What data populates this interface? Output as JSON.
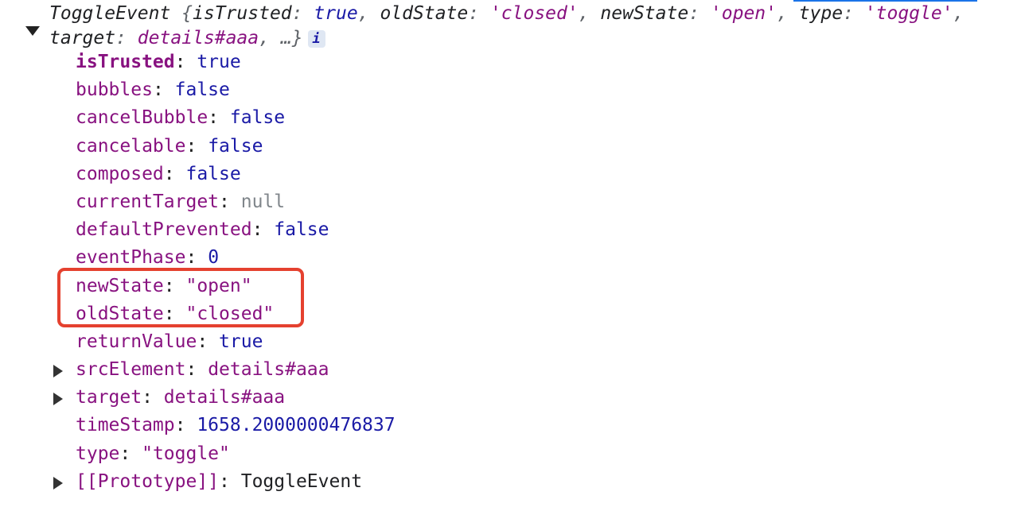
{
  "summary": {
    "class_name": "ToggleEvent",
    "entries": [
      {
        "key": "isTrusted",
        "value": "true",
        "kind": "bool"
      },
      {
        "key": "oldState",
        "value": "'closed'",
        "kind": "str"
      },
      {
        "key": "newState",
        "value": "'open'",
        "kind": "str"
      },
      {
        "key": "type",
        "value": "'toggle'",
        "kind": "str"
      },
      {
        "key": "target",
        "value": "details#aaa",
        "kind": "node"
      }
    ],
    "ellipsis": "…",
    "info_badge": "i"
  },
  "properties": [
    {
      "key": "isTrusted",
      "value": "true",
      "kind": "bool",
      "own": true,
      "expandable": false
    },
    {
      "key": "bubbles",
      "value": "false",
      "kind": "bool",
      "own": false,
      "expandable": false
    },
    {
      "key": "cancelBubble",
      "value": "false",
      "kind": "bool",
      "own": false,
      "expandable": false
    },
    {
      "key": "cancelable",
      "value": "false",
      "kind": "bool",
      "own": false,
      "expandable": false
    },
    {
      "key": "composed",
      "value": "false",
      "kind": "bool",
      "own": false,
      "expandable": false
    },
    {
      "key": "currentTarget",
      "value": "null",
      "kind": "null",
      "own": false,
      "expandable": false
    },
    {
      "key": "defaultPrevented",
      "value": "false",
      "kind": "bool",
      "own": false,
      "expandable": false
    },
    {
      "key": "eventPhase",
      "value": "0",
      "kind": "num",
      "own": false,
      "expandable": false
    },
    {
      "key": "newState",
      "value": "\"open\"",
      "kind": "str",
      "own": false,
      "expandable": false
    },
    {
      "key": "oldState",
      "value": "\"closed\"",
      "kind": "str",
      "own": false,
      "expandable": false
    },
    {
      "key": "returnValue",
      "value": "true",
      "kind": "bool",
      "own": false,
      "expandable": false
    },
    {
      "key": "srcElement",
      "value": "details#aaa",
      "kind": "node",
      "own": false,
      "expandable": true
    },
    {
      "key": "target",
      "value": "details#aaa",
      "kind": "node",
      "own": false,
      "expandable": true
    },
    {
      "key": "timeStamp",
      "value": "1658.2000000476837",
      "kind": "num",
      "own": false,
      "expandable": false
    },
    {
      "key": "type",
      "value": "\"toggle\"",
      "kind": "str",
      "own": false,
      "expandable": false
    },
    {
      "key": "[[Prototype]]",
      "value": "ToggleEvent",
      "kind": "obj",
      "own": false,
      "expandable": true
    }
  ],
  "colors": {
    "highlight_border": "#e5412f",
    "key": "#881280",
    "boolean_number": "#1a1aa6",
    "string": "#881280",
    "null": "#80868b"
  }
}
